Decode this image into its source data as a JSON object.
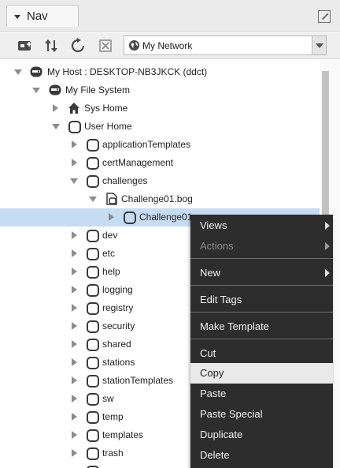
{
  "panel": {
    "title": "Nav"
  },
  "toolbar": {
    "network_label": "My Network"
  },
  "tree": {
    "host": "My Host : DESKTOP-NB3JKCK (ddct)",
    "file_system": "My File System",
    "sys_home": "Sys Home",
    "user_home": "User Home",
    "folders_a": [
      "applicationTemplates",
      "certManagement"
    ],
    "challenges": "challenges",
    "bog_file": "Challenge01.bog",
    "challenge_selected": "Challenge01",
    "folders_b": [
      "dev",
      "etc",
      "help",
      "logging",
      "registry",
      "security",
      "shared",
      "stations",
      "stationTemplates",
      "sw",
      "temp",
      "templates",
      "trash"
    ]
  },
  "context_menu": {
    "views": "Views",
    "actions": "Actions",
    "new": "New",
    "edit_tags": "Edit Tags",
    "make_template": "Make Template",
    "cut": "Cut",
    "copy": "Copy",
    "paste": "Paste",
    "paste_special": "Paste Special",
    "duplicate": "Duplicate",
    "delete": "Delete"
  },
  "colors": {
    "selection": "#c6dcf3",
    "menu_bg": "#2d2d2d",
    "menu_hover": "#e9e9e9"
  }
}
